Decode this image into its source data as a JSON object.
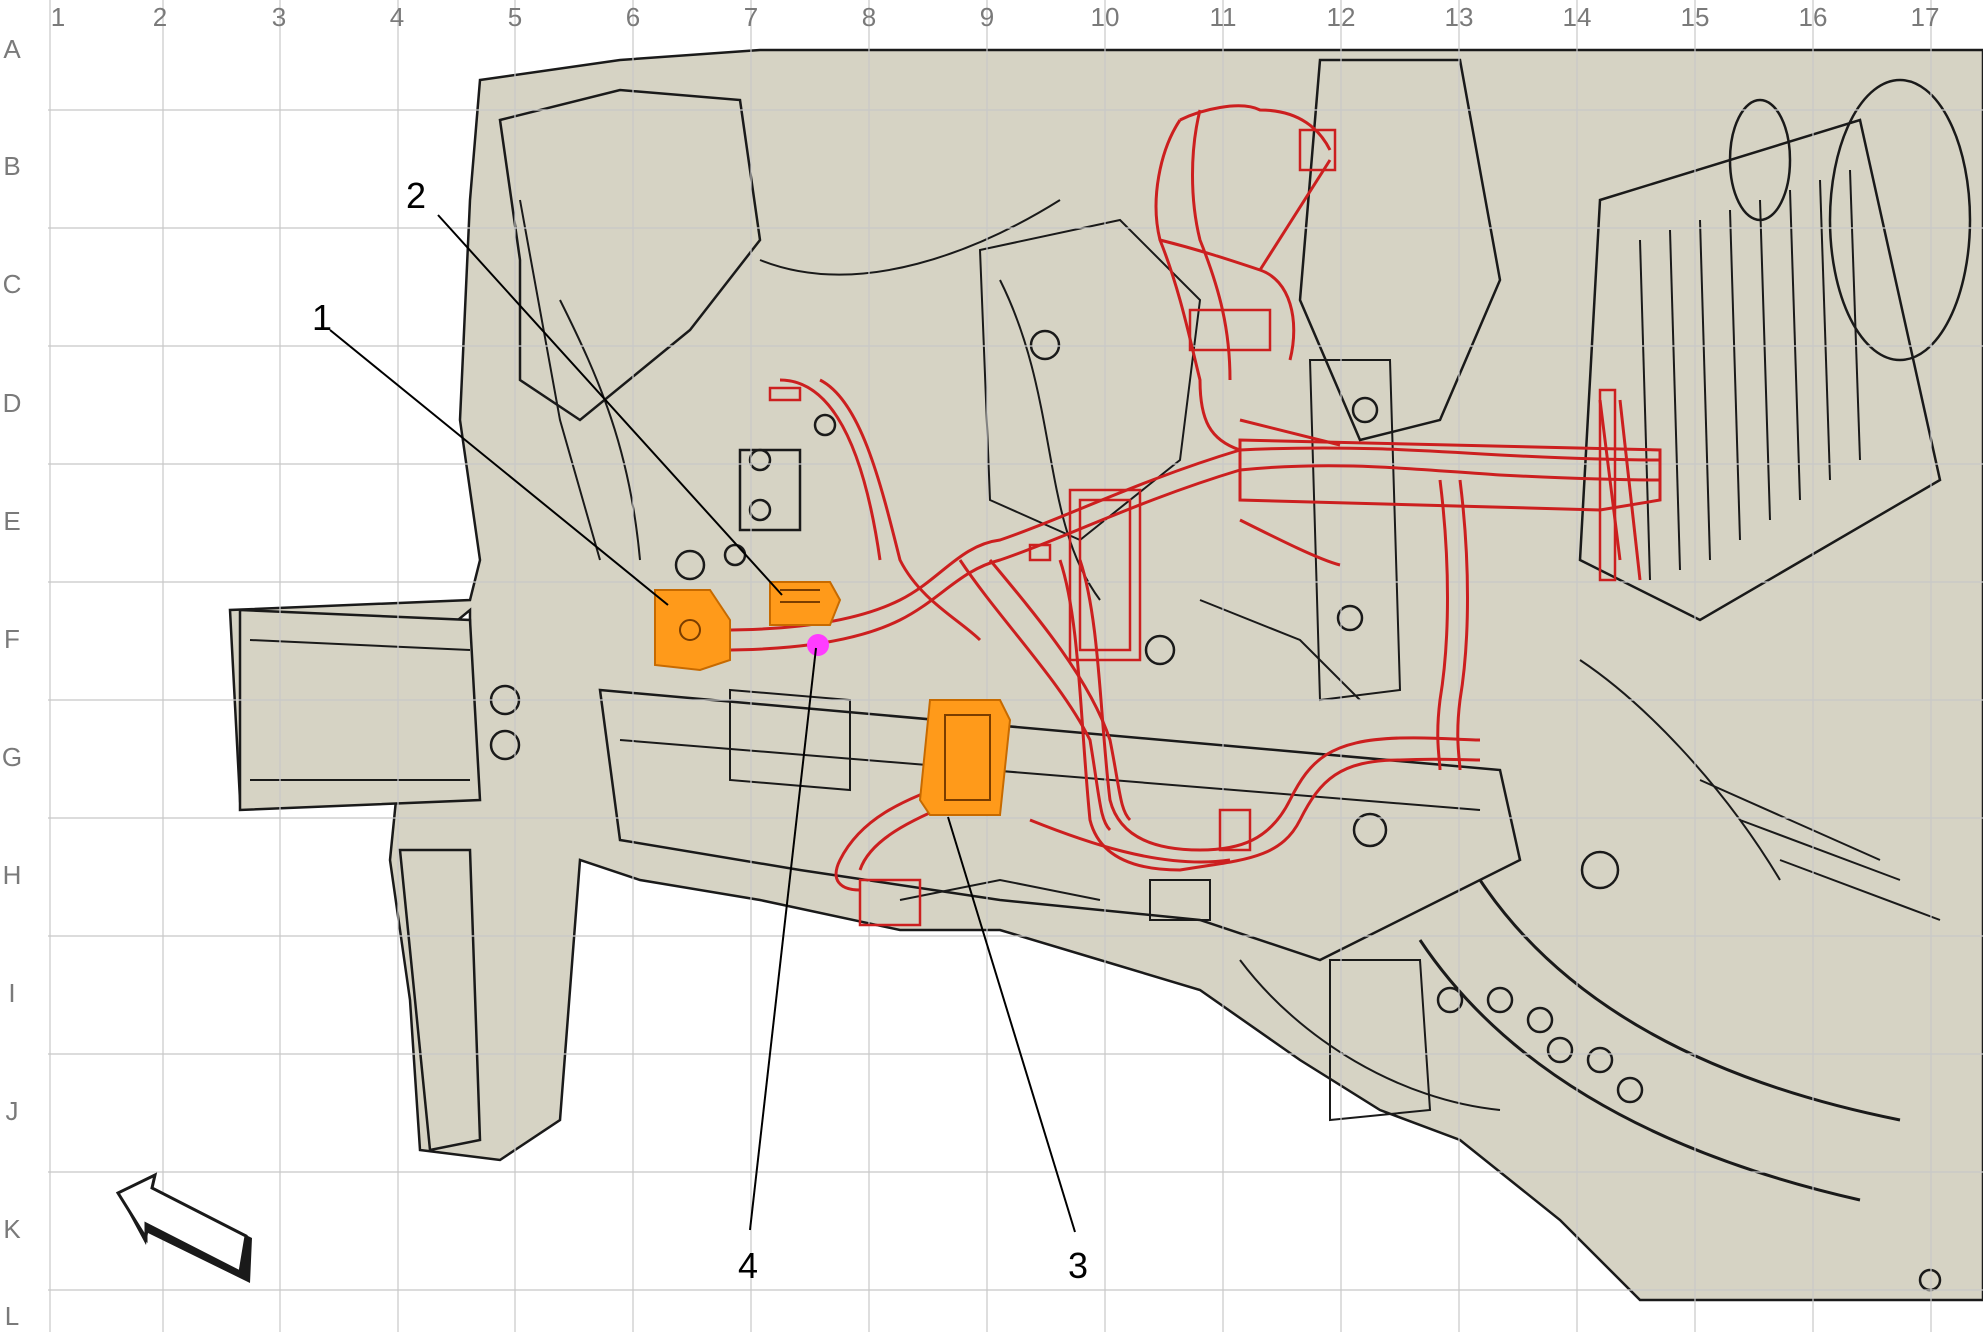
{
  "grid": {
    "columns": [
      "1",
      "2",
      "3",
      "4",
      "5",
      "6",
      "7",
      "8",
      "9",
      "10",
      "11",
      "12",
      "13",
      "14",
      "15",
      "16",
      "17"
    ],
    "rows": [
      "A",
      "B",
      "C",
      "D",
      "E",
      "F",
      "G",
      "H",
      "I",
      "J",
      "K",
      "L"
    ]
  },
  "callouts": [
    {
      "id": "1",
      "label": "1"
    },
    {
      "id": "2",
      "label": "2"
    },
    {
      "id": "3",
      "label": "3"
    },
    {
      "id": "4",
      "label": "4"
    }
  ],
  "colors": {
    "background": "#ffffff",
    "body_fill": "#d6d3c4",
    "structure_line": "#1a1a1a",
    "grid_line": "#c8c8c8",
    "harness": "#cc1f1f",
    "highlight_component": "#ff9a1a",
    "highlight_point": "#ff3cff"
  },
  "icons": {
    "orientation_arrow": "front-direction-arrow-icon"
  }
}
